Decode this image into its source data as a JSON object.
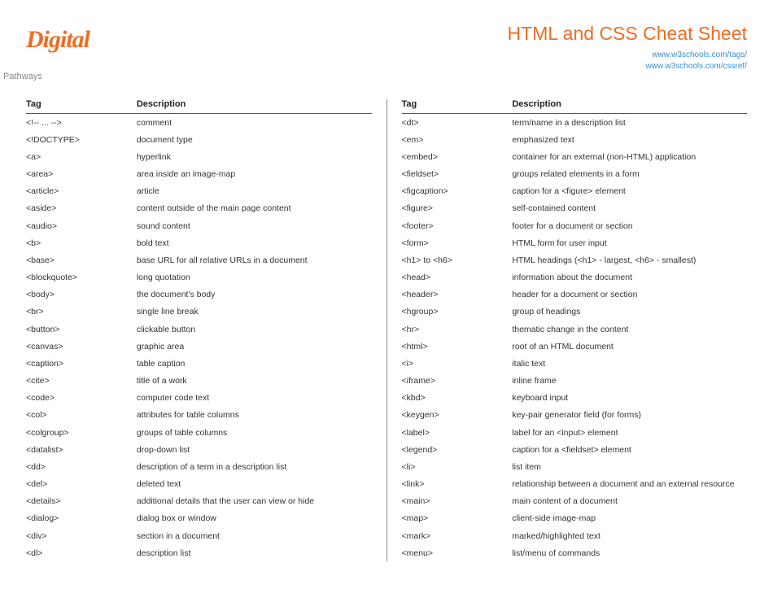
{
  "logo": {
    "main": "Digital",
    "sub": "Pathways"
  },
  "title": "HTML and CSS Cheat Sheet",
  "links": [
    "www.w3schools.com/tags/",
    "www.w3schools.com/cssref/"
  ],
  "headers": {
    "tag": "Tag",
    "desc": "Description"
  },
  "left": [
    {
      "t": "<!-- ... -->",
      "d": "comment"
    },
    {
      "t": "<!DOCTYPE>",
      "d": "document type"
    },
    {
      "t": "<a>",
      "d": "hyperlink"
    },
    {
      "t": "<area>",
      "d": "area inside an image-map"
    },
    {
      "t": "<article>",
      "d": "article"
    },
    {
      "t": "<aside>",
      "d": "content outside of the main page content"
    },
    {
      "t": "<audio>",
      "d": "sound content"
    },
    {
      "t": "<b>",
      "d": "bold text"
    },
    {
      "t": "<base>",
      "d": "base URL for all relative URLs in a document"
    },
    {
      "t": "<blockquote>",
      "d": "long quotation"
    },
    {
      "t": "<body>",
      "d": "the document's body"
    },
    {
      "t": "<br>",
      "d": "single line break"
    },
    {
      "t": "<button>",
      "d": "clickable button"
    },
    {
      "t": "<canvas>",
      "d": "graphic area"
    },
    {
      "t": "<caption>",
      "d": "table caption"
    },
    {
      "t": "<cite>",
      "d": "title of a work"
    },
    {
      "t": "<code>",
      "d": "computer code text"
    },
    {
      "t": "<col>",
      "d": "attributes for table columns"
    },
    {
      "t": "<colgroup>",
      "d": "groups of table columns"
    },
    {
      "t": "<datalist>",
      "d": "drop-down list"
    },
    {
      "t": "<dd>",
      "d": "description of a term in a description list"
    },
    {
      "t": "<del>",
      "d": "deleted text"
    },
    {
      "t": "<details>",
      "d": "additional details that the user can view or hide"
    },
    {
      "t": "<dialog>",
      "d": "dialog box or window"
    },
    {
      "t": "<div>",
      "d": "section in a document"
    },
    {
      "t": "<dl>",
      "d": "description list"
    }
  ],
  "right": [
    {
      "t": "<dt>",
      "d": "term/name in a description list"
    },
    {
      "t": "<em>",
      "d": "emphasized text"
    },
    {
      "t": "<embed>",
      "d": "container for an external (non-HTML) application"
    },
    {
      "t": "<fieldset>",
      "d": "groups related elements in a form"
    },
    {
      "t": "<figcaption>",
      "d": "caption for a <figure> element"
    },
    {
      "t": "<figure>",
      "d": "self-contained content"
    },
    {
      "t": "<footer>",
      "d": "footer for a document or section"
    },
    {
      "t": "<form>",
      "d": "HTML form for user input"
    },
    {
      "t": "<h1> to <h6>",
      "d": "HTML headings (<h1> - largest, <h6> - smallest)"
    },
    {
      "t": "<head>",
      "d": "information about the document"
    },
    {
      "t": "<header>",
      "d": "header for a document or section"
    },
    {
      "t": "<hgroup>",
      "d": "group of headings"
    },
    {
      "t": "<hr>",
      "d": "thematic change in the content"
    },
    {
      "t": "<html>",
      "d": "root of an HTML document"
    },
    {
      "t": "<i>",
      "d": "italic text"
    },
    {
      "t": "<iframe>",
      "d": "inline frame"
    },
    {
      "t": "<kbd>",
      "d": "keyboard input"
    },
    {
      "t": "<keygen>",
      "d": "key-pair generator field (for forms)"
    },
    {
      "t": "<label>",
      "d": "label for an <input> element"
    },
    {
      "t": "<legend>",
      "d": "caption for a <fieldset> element"
    },
    {
      "t": "<li>",
      "d": "list item"
    },
    {
      "t": "<link>",
      "d": "relationship between a document and an external resource"
    },
    {
      "t": "<main>",
      "d": "main content of a document"
    },
    {
      "t": "<map>",
      "d": "client-side image-map"
    },
    {
      "t": "<mark>",
      "d": "marked/highlighted text"
    },
    {
      "t": "<menu>",
      "d": "list/menu of commands"
    }
  ]
}
